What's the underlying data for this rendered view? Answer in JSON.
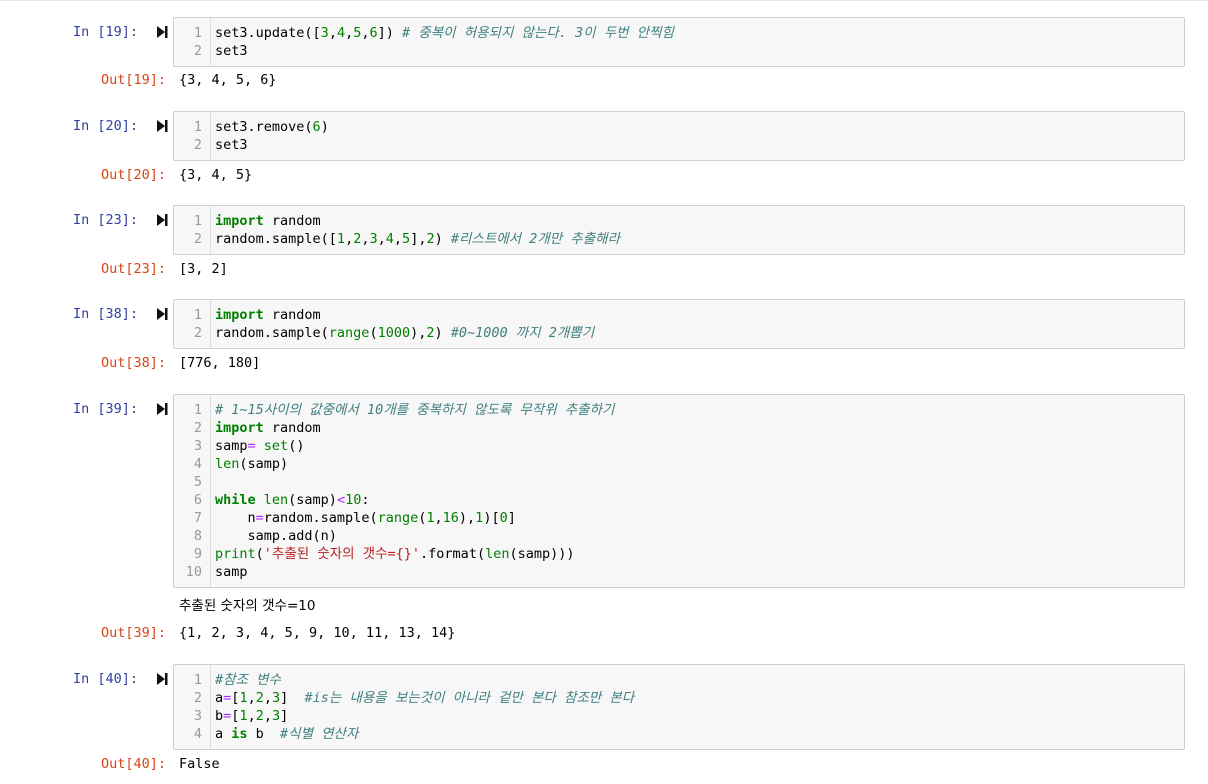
{
  "cells": [
    {
      "in_prompt": "In [19]:",
      "out_prompt": "Out[19]:",
      "output": "{3, 4, 5, 6}",
      "lines": [
        {
          "n": "1",
          "tokens": [
            [
              "nm",
              "set3.update(["
            ],
            [
              "num",
              "3"
            ],
            [
              "nm",
              ","
            ],
            [
              "num",
              "4"
            ],
            [
              "nm",
              ","
            ],
            [
              "num",
              "5"
            ],
            [
              "nm",
              ","
            ],
            [
              "num",
              "6"
            ],
            [
              "nm",
              "]) "
            ],
            [
              "cm",
              "# 중복이 허용되지 않는다. 3이 두번 안찍힘"
            ]
          ]
        },
        {
          "n": "2",
          "tokens": [
            [
              "nm",
              "set3"
            ]
          ]
        }
      ]
    },
    {
      "in_prompt": "In [20]:",
      "out_prompt": "Out[20]:",
      "output": "{3, 4, 5}",
      "lines": [
        {
          "n": "1",
          "tokens": [
            [
              "nm",
              "set3.remove("
            ],
            [
              "num",
              "6"
            ],
            [
              "nm",
              ")"
            ]
          ]
        },
        {
          "n": "2",
          "tokens": [
            [
              "nm",
              "set3"
            ]
          ]
        }
      ]
    },
    {
      "in_prompt": "In [23]:",
      "out_prompt": "Out[23]:",
      "output": "[3, 2]",
      "lines": [
        {
          "n": "1",
          "tokens": [
            [
              "kw",
              "import"
            ],
            [
              "nm",
              " random"
            ]
          ]
        },
        {
          "n": "2",
          "tokens": [
            [
              "nm",
              "random.sample(["
            ],
            [
              "num",
              "1"
            ],
            [
              "nm",
              ","
            ],
            [
              "num",
              "2"
            ],
            [
              "nm",
              ","
            ],
            [
              "num",
              "3"
            ],
            [
              "nm",
              ","
            ],
            [
              "num",
              "4"
            ],
            [
              "nm",
              ","
            ],
            [
              "num",
              "5"
            ],
            [
              "nm",
              "],"
            ],
            [
              "num",
              "2"
            ],
            [
              "nm",
              ") "
            ],
            [
              "cm",
              "#리스트에서 2개만 추출해라"
            ]
          ]
        }
      ]
    },
    {
      "in_prompt": "In [38]:",
      "out_prompt": "Out[38]:",
      "output": "[776, 180]",
      "lines": [
        {
          "n": "1",
          "tokens": [
            [
              "kw",
              "import"
            ],
            [
              "nm",
              " random"
            ]
          ]
        },
        {
          "n": "2",
          "tokens": [
            [
              "nm",
              "random.sample("
            ],
            [
              "bi",
              "range"
            ],
            [
              "nm",
              "("
            ],
            [
              "num",
              "1000"
            ],
            [
              "nm",
              "),"
            ],
            [
              "num",
              "2"
            ],
            [
              "nm",
              ") "
            ],
            [
              "cm",
              "#0~1000 까지 2개뽑기"
            ]
          ]
        }
      ]
    },
    {
      "in_prompt": "In [39]:",
      "out_prompt": "Out[39]:",
      "stdout": "추출된 숫자의 갯수=10",
      "output": "{1, 2, 3, 4, 5, 9, 10, 11, 13, 14}",
      "lines": [
        {
          "n": "1",
          "tokens": [
            [
              "cm",
              "# 1~15사이의 값중에서 10개를 중복하지 않도록 무작위 추출하기"
            ]
          ]
        },
        {
          "n": "2",
          "tokens": [
            [
              "kw",
              "import"
            ],
            [
              "nm",
              " random"
            ]
          ]
        },
        {
          "n": "3",
          "tokens": [
            [
              "nm",
              "samp"
            ],
            [
              "op",
              "="
            ],
            [
              "nm",
              " "
            ],
            [
              "bi",
              "set"
            ],
            [
              "nm",
              "()"
            ]
          ]
        },
        {
          "n": "4",
          "tokens": [
            [
              "bi",
              "len"
            ],
            [
              "nm",
              "(samp)"
            ]
          ]
        },
        {
          "n": "5",
          "tokens": []
        },
        {
          "n": "6",
          "tokens": [
            [
              "kw",
              "while"
            ],
            [
              "nm",
              " "
            ],
            [
              "bi",
              "len"
            ],
            [
              "nm",
              "(samp)"
            ],
            [
              "op",
              "<"
            ],
            [
              "num",
              "10"
            ],
            [
              "nm",
              ":"
            ]
          ]
        },
        {
          "n": "7",
          "tokens": [
            [
              "nm",
              "    n"
            ],
            [
              "op",
              "="
            ],
            [
              "nm",
              "random.sample("
            ],
            [
              "bi",
              "range"
            ],
            [
              "nm",
              "("
            ],
            [
              "num",
              "1"
            ],
            [
              "nm",
              ","
            ],
            [
              "num",
              "16"
            ],
            [
              "nm",
              "),"
            ],
            [
              "num",
              "1"
            ],
            [
              "nm",
              ")["
            ],
            [
              "num",
              "0"
            ],
            [
              "nm",
              "]"
            ]
          ]
        },
        {
          "n": "8",
          "tokens": [
            [
              "nm",
              "    samp.add(n)"
            ]
          ]
        },
        {
          "n": "9",
          "tokens": [
            [
              "bi",
              "print"
            ],
            [
              "nm",
              "("
            ],
            [
              "str",
              "'추출된 숫자의 갯수={}'"
            ],
            [
              "nm",
              ".format("
            ],
            [
              "bi",
              "len"
            ],
            [
              "nm",
              "(samp)))"
            ]
          ]
        },
        {
          "n": "10",
          "tokens": [
            [
              "nm",
              "samp"
            ]
          ]
        }
      ]
    },
    {
      "in_prompt": "In [40]:",
      "out_prompt": "Out[40]:",
      "output": "False",
      "lines": [
        {
          "n": "1",
          "tokens": [
            [
              "cm",
              "#참조 변수"
            ]
          ]
        },
        {
          "n": "2",
          "tokens": [
            [
              "nm",
              "a"
            ],
            [
              "op",
              "="
            ],
            [
              "nm",
              "["
            ],
            [
              "num",
              "1"
            ],
            [
              "nm",
              ","
            ],
            [
              "num",
              "2"
            ],
            [
              "nm",
              ","
            ],
            [
              "num",
              "3"
            ],
            [
              "nm",
              "]  "
            ],
            [
              "cm",
              "#is는 내용을 보는것이 아니라 겉만 본다 참조만 본다"
            ]
          ]
        },
        {
          "n": "3",
          "tokens": [
            [
              "nm",
              "b"
            ],
            [
              "op",
              "="
            ],
            [
              "nm",
              "["
            ],
            [
              "num",
              "1"
            ],
            [
              "nm",
              ","
            ],
            [
              "num",
              "2"
            ],
            [
              "nm",
              ","
            ],
            [
              "num",
              "3"
            ],
            [
              "nm",
              "]"
            ]
          ]
        },
        {
          "n": "4",
          "tokens": [
            [
              "nm",
              "a "
            ],
            [
              "kw",
              "is"
            ],
            [
              "nm",
              " b  "
            ],
            [
              "cm",
              "#식별 연산자"
            ]
          ]
        }
      ]
    }
  ]
}
